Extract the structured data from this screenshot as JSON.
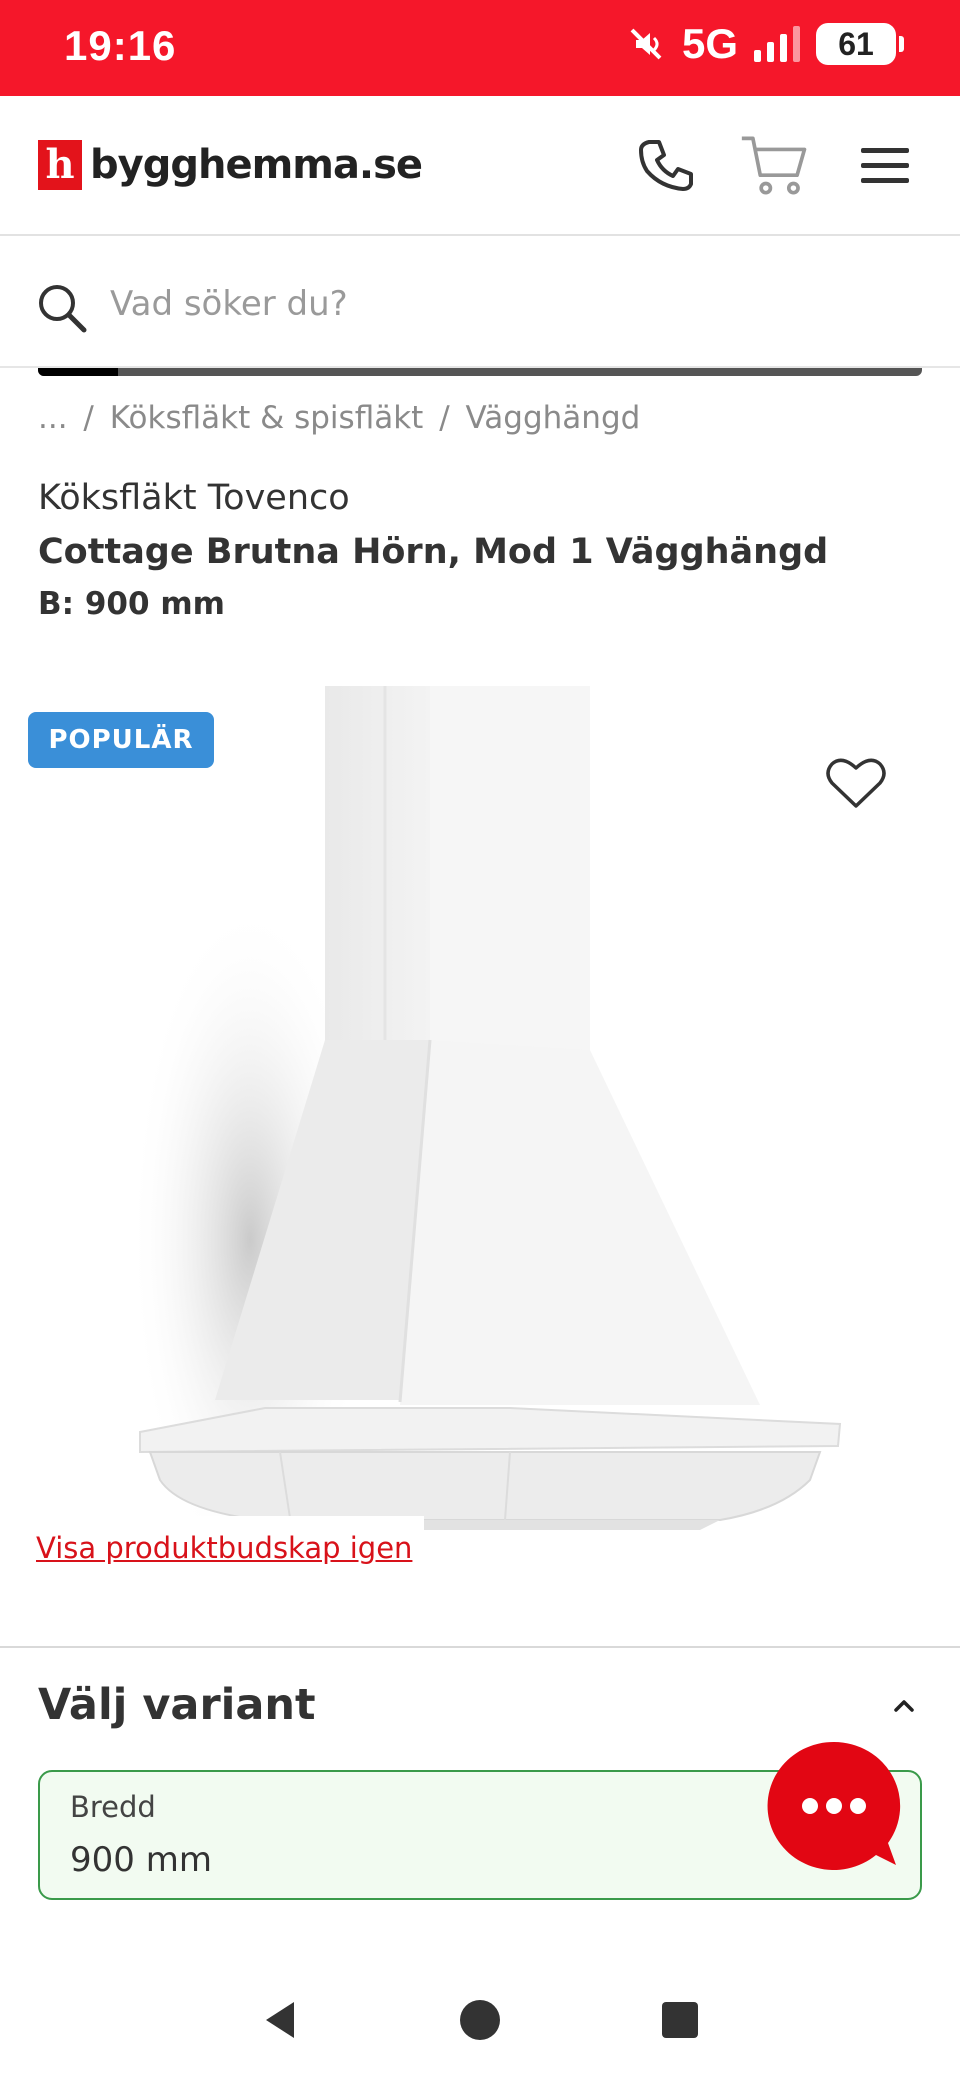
{
  "status": {
    "time": "19:16",
    "network": "5G",
    "battery": "61"
  },
  "header": {
    "logo_letter": "h",
    "logo_text": "bygghemma.se"
  },
  "search": {
    "placeholder": "Vad söker du?"
  },
  "breadcrumb": {
    "items": [
      "...",
      "/",
      "Köksfläkt & spisfläkt",
      "/",
      "Vägghängd"
    ]
  },
  "product": {
    "brand": "Köksfläkt Tovenco",
    "title": "Cottage Brutna Hörn, Mod 1 Vägghängd",
    "size": "B: 900 mm",
    "badge": "POPULÄR",
    "revisit_link": "Visa produktbudskap igen"
  },
  "variant": {
    "heading": "Välj variant",
    "field_label": "Bredd",
    "field_value": "900 mm"
  },
  "colors": {
    "brand_red": "#f5172a",
    "badge_blue": "#3a8fd8",
    "variant_green": "#3a9a4a"
  },
  "icons": {
    "phone": "phone-icon",
    "cart": "cart-icon",
    "menu": "menu-icon",
    "search": "search-icon",
    "heart": "heart-icon",
    "chevron": "chevron-up-icon",
    "chat": "chat-icon"
  }
}
